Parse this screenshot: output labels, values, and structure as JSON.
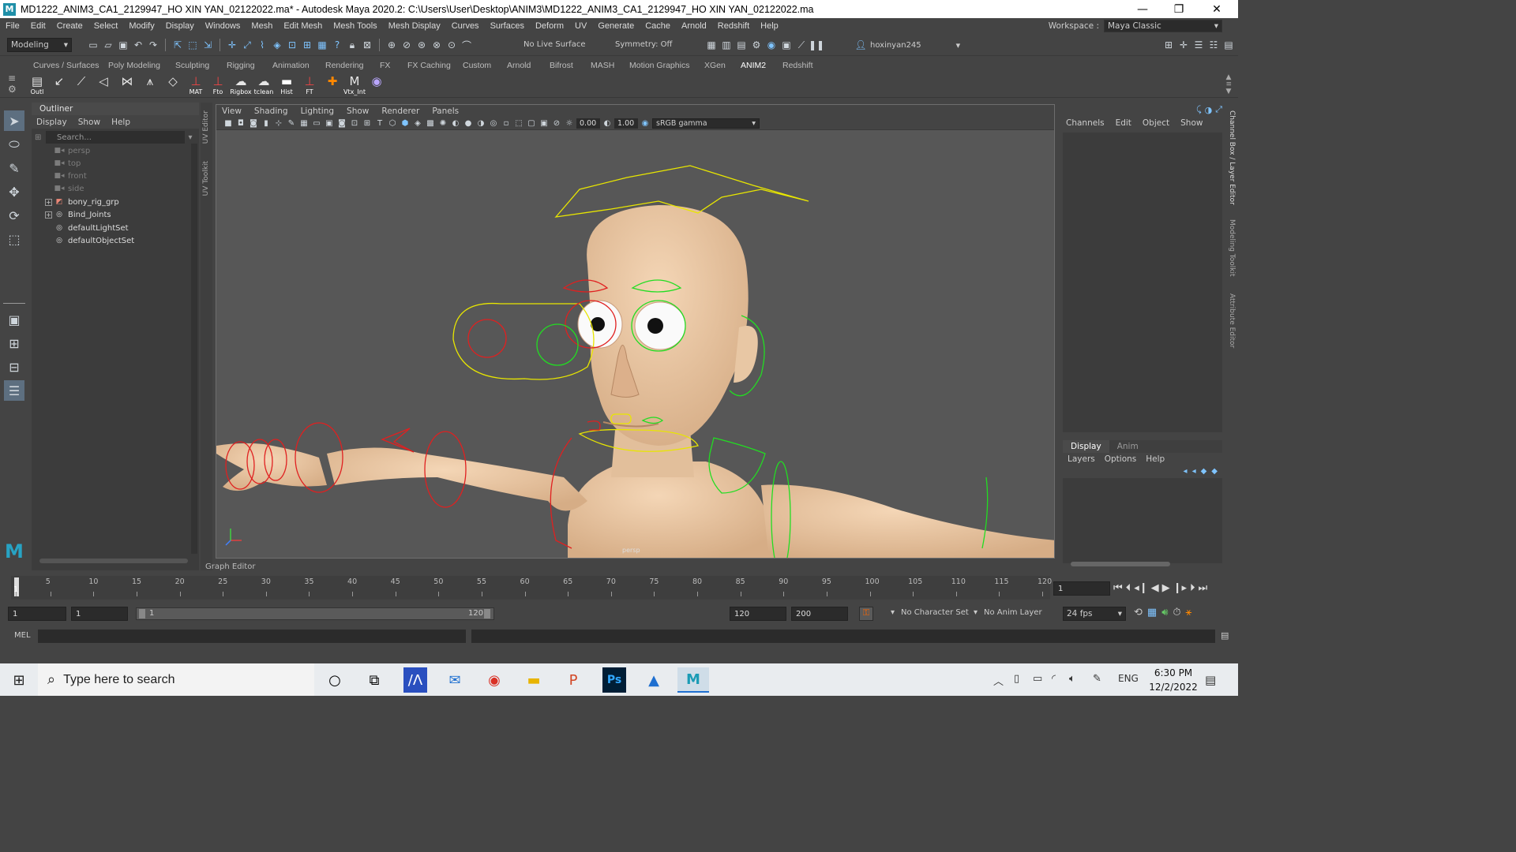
{
  "window": {
    "title": "MD1222_ANIM3_CA1_2129947_HO XIN YAN_02122022.ma* - Autodesk Maya 2020.2: C:\\Users\\User\\Desktop\\ANIM3\\MD1222_ANIM3_CA1_2129947_HO XIN YAN_02122022.ma",
    "logo": "M",
    "minimize": "—",
    "restore": "❐",
    "close": "✕"
  },
  "menubar": {
    "items": [
      "File",
      "Edit",
      "Create",
      "Select",
      "Modify",
      "Display",
      "Windows",
      "Mesh",
      "Edit Mesh",
      "Mesh Tools",
      "Mesh Display",
      "Curves",
      "Surfaces",
      "Deform",
      "UV",
      "Generate",
      "Cache",
      "Arnold",
      "Redshift",
      "Help"
    ],
    "workspace_label": "Workspace :",
    "workspace_value": "Maya Classic"
  },
  "statusline": {
    "mode": "Modeling",
    "live_surface": "No Live Surface",
    "symmetry": "Symmetry: Off",
    "user": "hoxinyan245"
  },
  "shelf": {
    "tabs": [
      "Curves / Surfaces",
      "Poly Modeling",
      "Sculpting",
      "Rigging",
      "Animation",
      "Rendering",
      "FX",
      "FX Caching",
      "Custom",
      "Arnold",
      "Bifrost",
      "MASH",
      "Motion Graphics",
      "XGen",
      "ANIM2",
      "Redshift"
    ],
    "active_tab": "ANIM2",
    "icons": [
      {
        "name": "outliner",
        "glyph": "▤",
        "label": "Outl"
      },
      {
        "name": "joint-tool",
        "glyph": "↙",
        "label": ""
      },
      {
        "name": "ik-handle",
        "glyph": "⟋",
        "label": ""
      },
      {
        "name": "ik-spline",
        "glyph": "◁",
        "label": ""
      },
      {
        "name": "bind-skin",
        "glyph": "⋈",
        "label": ""
      },
      {
        "name": "paint-weights",
        "glyph": "⩚",
        "label": ""
      },
      {
        "name": "control-curve",
        "glyph": "◇",
        "label": ""
      },
      {
        "name": "mat",
        "glyph": "⊥",
        "label": "MAT"
      },
      {
        "name": "fto",
        "glyph": "⊥",
        "label": "Fto"
      },
      {
        "name": "rigbox",
        "glyph": "☁",
        "label": "Rigbox"
      },
      {
        "name": "tclean",
        "glyph": "☁",
        "label": "tclean"
      },
      {
        "name": "hist",
        "glyph": "▬",
        "label": "Hist"
      },
      {
        "name": "ft",
        "glyph": "⊥",
        "label": "FT"
      },
      {
        "name": "pin",
        "glyph": "✚",
        "label": ""
      },
      {
        "name": "vtx-int",
        "glyph": "M",
        "label": "Vtx_Int"
      },
      {
        "name": "snapshot",
        "glyph": "◉",
        "label": ""
      }
    ]
  },
  "outliner": {
    "title": "Outliner",
    "menu": [
      "Display",
      "Show",
      "Help"
    ],
    "search_placeholder": "Search...",
    "items": [
      {
        "label": "persp",
        "icon": "camera",
        "dim": true,
        "expandable": false
      },
      {
        "label": "top",
        "icon": "camera",
        "dim": true,
        "expandable": false
      },
      {
        "label": "front",
        "icon": "camera",
        "dim": true,
        "expandable": false
      },
      {
        "label": "side",
        "icon": "camera",
        "dim": true,
        "expandable": false
      },
      {
        "label": "bony_rig_grp",
        "icon": "group",
        "dim": false,
        "expandable": true
      },
      {
        "label": "Bind_Joints",
        "icon": "set",
        "dim": false,
        "expandable": true
      },
      {
        "label": "defaultLightSet",
        "icon": "set",
        "dim": false,
        "expandable": false
      },
      {
        "label": "defaultObjectSet",
        "icon": "set",
        "dim": false,
        "expandable": false
      }
    ]
  },
  "sidestrip": {
    "uv_editor": "UV Editor",
    "uv_toolkit": "UV Toolkit"
  },
  "viewport": {
    "menu": [
      "View",
      "Shading",
      "Lighting",
      "Show",
      "Renderer",
      "Panels"
    ],
    "exposure": "0.00",
    "gamma": "1.00",
    "color_space": "sRGB gamma",
    "camera_label": "persp"
  },
  "channelbox": {
    "menu": [
      "Channels",
      "Edit",
      "Object",
      "Show"
    ],
    "layer_tabs": [
      "Display",
      "Anim"
    ],
    "layer_menu": [
      "Layers",
      "Options",
      "Help"
    ],
    "side_labels": [
      "Channel Box / Layer Editor",
      "Modeling Toolkit",
      "Attribute Editor"
    ]
  },
  "graph_editor_label": "Graph Editor",
  "timeslider": {
    "ticks": [
      "1",
      "5",
      "10",
      "15",
      "20",
      "25",
      "30",
      "35",
      "40",
      "45",
      "50",
      "55",
      "60",
      "65",
      "70",
      "75",
      "80",
      "85",
      "90",
      "95",
      "100",
      "105",
      "110",
      "115",
      "120"
    ],
    "current_frame": "1",
    "start": 1,
    "end": 120
  },
  "rangeslider": {
    "start_time": "1",
    "playback_start": "1",
    "range_start_label": "1",
    "range_end_label": "120",
    "playback_end": "120",
    "end_time": "200",
    "character_set": "No Character Set",
    "anim_layer": "No Anim Layer",
    "fps": "24 fps"
  },
  "cmdline": {
    "label": "MEL"
  },
  "taskbar": {
    "search_placeholder": "Type here to search",
    "time": "6:30 PM",
    "date": "12/2/2022",
    "lang": "ENG"
  }
}
